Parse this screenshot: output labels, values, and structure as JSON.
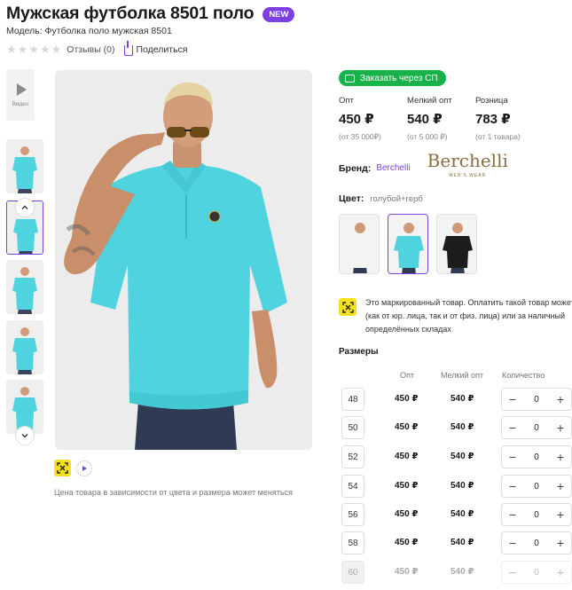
{
  "product": {
    "title": "Мужская футболка 8501 поло",
    "badge": "NEW",
    "model": "Модель: Футболка поло мужская 8501",
    "reviews": "Отзывы (0)",
    "share": "Поделиться"
  },
  "gallery": {
    "video_label": "Видео",
    "thumb_count": 5,
    "selected_thumb": 1,
    "price_note": "Цена товара в зависимости от цвета и размера может меняться"
  },
  "buy": {
    "sp_button": "Заказать через СП",
    "prices": [
      {
        "label": "Опт",
        "value": "450 ₽",
        "sub": "(от 35 000₽)"
      },
      {
        "label": "Мелкий опт",
        "value": "540 ₽",
        "sub": "(от 5 000 ₽)"
      },
      {
        "label": "Розница",
        "value": "783 ₽",
        "sub": "(от 1 товара)"
      }
    ]
  },
  "brand": {
    "label": "Бренд:",
    "link": "Berchelli",
    "logo_text": "Berchelli",
    "logo_sub": "MEN'S WEAR"
  },
  "color": {
    "label": "Цвет:",
    "value": "голубой+герб",
    "swatches": [
      {
        "name": "white",
        "shirt": "#f4f4f4",
        "selected": false
      },
      {
        "name": "turquoise",
        "shirt": "#4fd4df",
        "selected": true
      },
      {
        "name": "black",
        "shirt": "#1d1d1d",
        "selected": false
      }
    ]
  },
  "marking": {
    "text": "Это маркированный товар. Оплатить такой товар может (как от юр. лица, так и от физ. лица) или за наличный определённых складах"
  },
  "sizes": {
    "title": "Размеры",
    "headers": {
      "opt": "Опт",
      "small_opt": "Мелкий опт",
      "qty": "Количество"
    },
    "rows": [
      {
        "size": "48",
        "opt": "450 ₽",
        "small": "540 ₽",
        "qty": "0",
        "disabled": false
      },
      {
        "size": "50",
        "opt": "450 ₽",
        "small": "540 ₽",
        "qty": "0",
        "disabled": false
      },
      {
        "size": "52",
        "opt": "450 ₽",
        "small": "540 ₽",
        "qty": "0",
        "disabled": false
      },
      {
        "size": "54",
        "opt": "450 ₽",
        "small": "540 ₽",
        "qty": "0",
        "disabled": false
      },
      {
        "size": "56",
        "opt": "450 ₽",
        "small": "540 ₽",
        "qty": "0",
        "disabled": false
      },
      {
        "size": "58",
        "opt": "450 ₽",
        "small": "540 ₽",
        "qty": "0",
        "disabled": false
      },
      {
        "size": "60",
        "opt": "450 ₽",
        "small": "540 ₽",
        "qty": "0",
        "disabled": true
      }
    ],
    "minus": "−",
    "plus": "+"
  },
  "colors": {
    "accent": "#7b3fe4",
    "green": "#17b24a",
    "mark_yellow": "#f5e020",
    "shirt_turquoise": "#4fd4df"
  }
}
